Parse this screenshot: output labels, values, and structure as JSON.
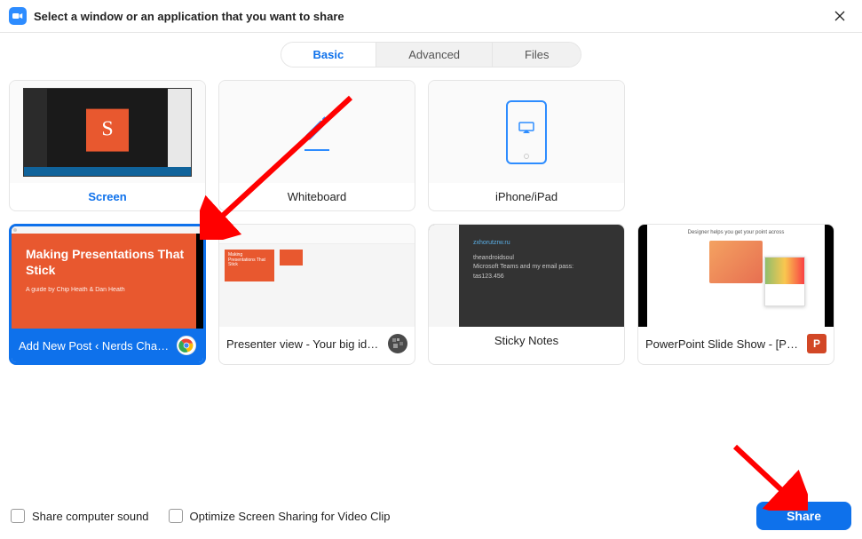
{
  "window": {
    "title": "Select a window or an application that you want to share"
  },
  "tabs": {
    "basic": "Basic",
    "advanced": "Advanced",
    "files": "Files"
  },
  "tiles": {
    "screen": "Screen",
    "whiteboard": "Whiteboard",
    "iphone": "iPhone/iPad",
    "chrome_window": "Add New Post ‹ Nerds Chalk — ...",
    "presenter_view": "Presenter view - Your big idea - G...",
    "sticky_notes": "Sticky Notes",
    "powerpoint": "PowerPoint Slide Show - [Present..."
  },
  "preview_content": {
    "orange_slide_title": "Making Presentations That Stick",
    "orange_slide_sub": "A guide by Chip Heath & Dan Heath",
    "presenter_mini": "Making\nPresentations That\nStick",
    "sticky_link": "zxhorutzrw.ru",
    "sticky_line1": "theandroidsoul",
    "sticky_line2": "Microsoft Teams and my email pass:",
    "sticky_line3": "tas123.456",
    "ppt_headline": "Designer helps you get your point across",
    "screen_letter": "S"
  },
  "footer": {
    "share_sound": "Share computer sound",
    "optimize": "Optimize Screen Sharing for Video Clip",
    "share_button": "Share"
  },
  "colors": {
    "accent": "#0E71EB",
    "orange": "#E8582F",
    "ppt": "#D24726"
  }
}
